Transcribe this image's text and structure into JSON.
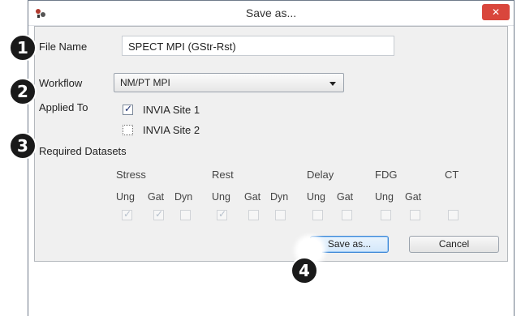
{
  "window": {
    "title": "Save as...",
    "close_glyph": "✕",
    "app_icon": "app-logo-icon"
  },
  "form": {
    "file_name_label": "File Name",
    "file_name_value": "SPECT MPI (GStr-Rst)",
    "workflow_label": "Workflow",
    "workflow_value": "NM/PT MPI",
    "applied_to_label": "Applied To",
    "sites": [
      {
        "label": "INVIA Site 1",
        "checked": true
      },
      {
        "label": "INVIA Site 2",
        "checked": false
      }
    ],
    "required_datasets_label": "Required Datasets"
  },
  "datasets": {
    "groups": [
      {
        "name": "Stress",
        "subs": [
          {
            "label": "Ung",
            "checked": true
          },
          {
            "label": "Gat",
            "checked": true
          },
          {
            "label": "Dyn",
            "checked": false
          }
        ]
      },
      {
        "name": "Rest",
        "subs": [
          {
            "label": "Ung",
            "checked": true
          },
          {
            "label": "Gat",
            "checked": false
          },
          {
            "label": "Dyn",
            "checked": false
          }
        ]
      },
      {
        "name": "Delay",
        "subs": [
          {
            "label": "Ung",
            "checked": false
          },
          {
            "label": "Gat",
            "checked": false
          }
        ]
      },
      {
        "name": "FDG",
        "subs": [
          {
            "label": "Ung",
            "checked": false
          },
          {
            "label": "Gat",
            "checked": false
          }
        ]
      },
      {
        "name": "CT",
        "subs": [
          {
            "label": "",
            "checked": false
          }
        ]
      }
    ]
  },
  "buttons": {
    "save_label": "Save as...",
    "cancel_label": "Cancel"
  },
  "callouts": [
    "1",
    "2",
    "3",
    "4"
  ],
  "colors": {
    "close_red": "#d9463c",
    "default_button_blue": "#3b86d6",
    "dialog_gray": "#f0f0f0",
    "callout_black": "#1a1a1a"
  }
}
